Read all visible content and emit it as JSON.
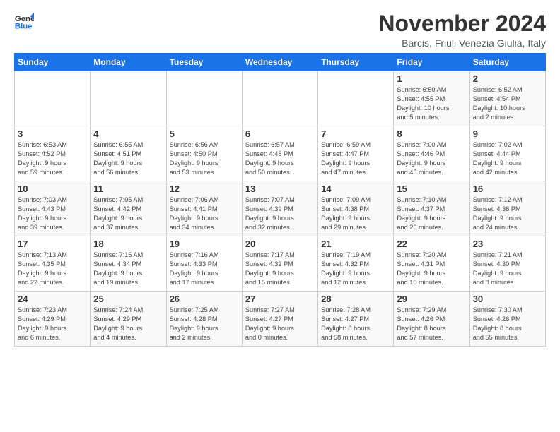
{
  "logo": {
    "general": "General",
    "blue": "Blue"
  },
  "header": {
    "month": "November 2024",
    "location": "Barcis, Friuli Venezia Giulia, Italy"
  },
  "weekdays": [
    "Sunday",
    "Monday",
    "Tuesday",
    "Wednesday",
    "Thursday",
    "Friday",
    "Saturday"
  ],
  "weeks": [
    [
      {
        "day": "",
        "info": ""
      },
      {
        "day": "",
        "info": ""
      },
      {
        "day": "",
        "info": ""
      },
      {
        "day": "",
        "info": ""
      },
      {
        "day": "",
        "info": ""
      },
      {
        "day": "1",
        "info": "Sunrise: 6:50 AM\nSunset: 4:55 PM\nDaylight: 10 hours\nand 5 minutes."
      },
      {
        "day": "2",
        "info": "Sunrise: 6:52 AM\nSunset: 4:54 PM\nDaylight: 10 hours\nand 2 minutes."
      }
    ],
    [
      {
        "day": "3",
        "info": "Sunrise: 6:53 AM\nSunset: 4:52 PM\nDaylight: 9 hours\nand 59 minutes."
      },
      {
        "day": "4",
        "info": "Sunrise: 6:55 AM\nSunset: 4:51 PM\nDaylight: 9 hours\nand 56 minutes."
      },
      {
        "day": "5",
        "info": "Sunrise: 6:56 AM\nSunset: 4:50 PM\nDaylight: 9 hours\nand 53 minutes."
      },
      {
        "day": "6",
        "info": "Sunrise: 6:57 AM\nSunset: 4:48 PM\nDaylight: 9 hours\nand 50 minutes."
      },
      {
        "day": "7",
        "info": "Sunrise: 6:59 AM\nSunset: 4:47 PM\nDaylight: 9 hours\nand 47 minutes."
      },
      {
        "day": "8",
        "info": "Sunrise: 7:00 AM\nSunset: 4:46 PM\nDaylight: 9 hours\nand 45 minutes."
      },
      {
        "day": "9",
        "info": "Sunrise: 7:02 AM\nSunset: 4:44 PM\nDaylight: 9 hours\nand 42 minutes."
      }
    ],
    [
      {
        "day": "10",
        "info": "Sunrise: 7:03 AM\nSunset: 4:43 PM\nDaylight: 9 hours\nand 39 minutes."
      },
      {
        "day": "11",
        "info": "Sunrise: 7:05 AM\nSunset: 4:42 PM\nDaylight: 9 hours\nand 37 minutes."
      },
      {
        "day": "12",
        "info": "Sunrise: 7:06 AM\nSunset: 4:41 PM\nDaylight: 9 hours\nand 34 minutes."
      },
      {
        "day": "13",
        "info": "Sunrise: 7:07 AM\nSunset: 4:39 PM\nDaylight: 9 hours\nand 32 minutes."
      },
      {
        "day": "14",
        "info": "Sunrise: 7:09 AM\nSunset: 4:38 PM\nDaylight: 9 hours\nand 29 minutes."
      },
      {
        "day": "15",
        "info": "Sunrise: 7:10 AM\nSunset: 4:37 PM\nDaylight: 9 hours\nand 26 minutes."
      },
      {
        "day": "16",
        "info": "Sunrise: 7:12 AM\nSunset: 4:36 PM\nDaylight: 9 hours\nand 24 minutes."
      }
    ],
    [
      {
        "day": "17",
        "info": "Sunrise: 7:13 AM\nSunset: 4:35 PM\nDaylight: 9 hours\nand 22 minutes."
      },
      {
        "day": "18",
        "info": "Sunrise: 7:15 AM\nSunset: 4:34 PM\nDaylight: 9 hours\nand 19 minutes."
      },
      {
        "day": "19",
        "info": "Sunrise: 7:16 AM\nSunset: 4:33 PM\nDaylight: 9 hours\nand 17 minutes."
      },
      {
        "day": "20",
        "info": "Sunrise: 7:17 AM\nSunset: 4:32 PM\nDaylight: 9 hours\nand 15 minutes."
      },
      {
        "day": "21",
        "info": "Sunrise: 7:19 AM\nSunset: 4:32 PM\nDaylight: 9 hours\nand 12 minutes."
      },
      {
        "day": "22",
        "info": "Sunrise: 7:20 AM\nSunset: 4:31 PM\nDaylight: 9 hours\nand 10 minutes."
      },
      {
        "day": "23",
        "info": "Sunrise: 7:21 AM\nSunset: 4:30 PM\nDaylight: 9 hours\nand 8 minutes."
      }
    ],
    [
      {
        "day": "24",
        "info": "Sunrise: 7:23 AM\nSunset: 4:29 PM\nDaylight: 9 hours\nand 6 minutes."
      },
      {
        "day": "25",
        "info": "Sunrise: 7:24 AM\nSunset: 4:29 PM\nDaylight: 9 hours\nand 4 minutes."
      },
      {
        "day": "26",
        "info": "Sunrise: 7:25 AM\nSunset: 4:28 PM\nDaylight: 9 hours\nand 2 minutes."
      },
      {
        "day": "27",
        "info": "Sunrise: 7:27 AM\nSunset: 4:27 PM\nDaylight: 9 hours\nand 0 minutes."
      },
      {
        "day": "28",
        "info": "Sunrise: 7:28 AM\nSunset: 4:27 PM\nDaylight: 8 hours\nand 58 minutes."
      },
      {
        "day": "29",
        "info": "Sunrise: 7:29 AM\nSunset: 4:26 PM\nDaylight: 8 hours\nand 57 minutes."
      },
      {
        "day": "30",
        "info": "Sunrise: 7:30 AM\nSunset: 4:26 PM\nDaylight: 8 hours\nand 55 minutes."
      }
    ]
  ]
}
